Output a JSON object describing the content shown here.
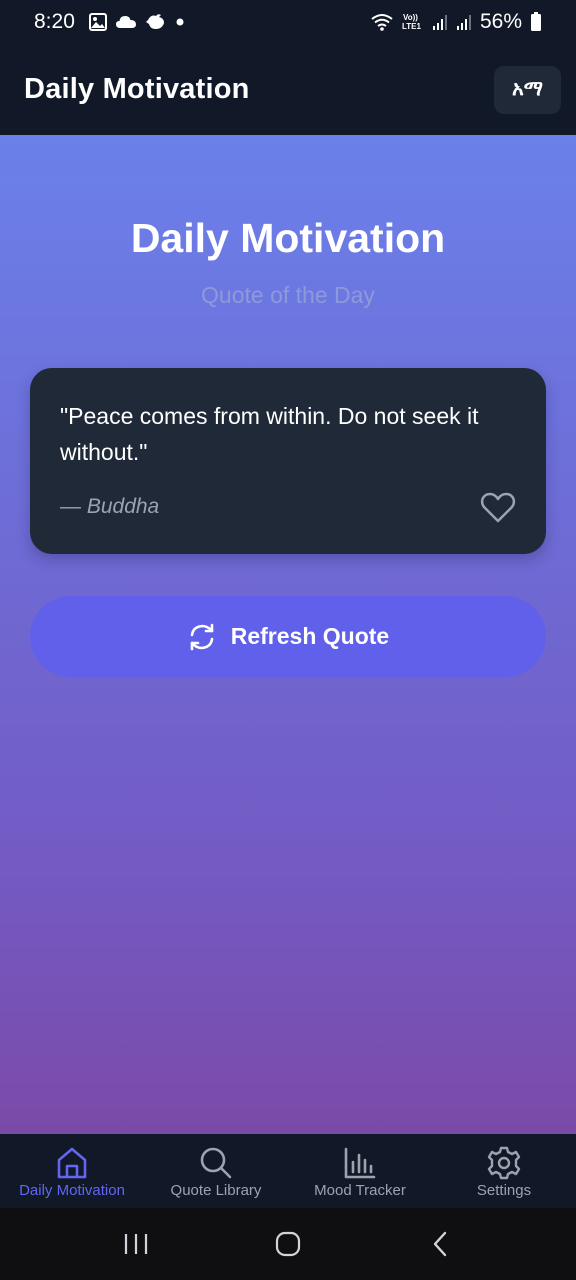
{
  "status_bar": {
    "time": "8:20",
    "icons_left": [
      "gallery-icon",
      "cloud-icon",
      "bird-icon",
      "dot-icon"
    ],
    "icons_right": [
      "wifi-icon",
      "volte-icon",
      "signal-icon",
      "signal-icon-2",
      "battery-icon"
    ],
    "volte_label": "Vo))\nLTE1",
    "battery_percent": "56%"
  },
  "header": {
    "title": "Daily Motivation",
    "lang_button_label": "አማ"
  },
  "main": {
    "title": "Daily Motivation",
    "subtitle": "Quote of the Day",
    "quote": {
      "text": "\"Peace comes from within. Do not seek it without.\"",
      "author": "— Buddha",
      "favorite_icon": "heart-outline-icon"
    },
    "refresh_button": {
      "label": "Refresh Quote",
      "icon": "refresh-icon"
    }
  },
  "bottom_nav": {
    "items": [
      {
        "label": "Daily Motivation",
        "icon": "home-icon",
        "active": true
      },
      {
        "label": "Quote Library",
        "icon": "search-icon",
        "active": false
      },
      {
        "label": "Mood Tracker",
        "icon": "bar-chart-icon",
        "active": false
      },
      {
        "label": "Settings",
        "icon": "gear-icon",
        "active": false
      }
    ]
  },
  "colors": {
    "background_dark": "#111827",
    "card": "#1f2937",
    "accent": "#6366f1",
    "nav_inactive": "#9ca3af",
    "gradient_top": "#6b80ea",
    "gradient_bottom": "#7b4aa8"
  }
}
